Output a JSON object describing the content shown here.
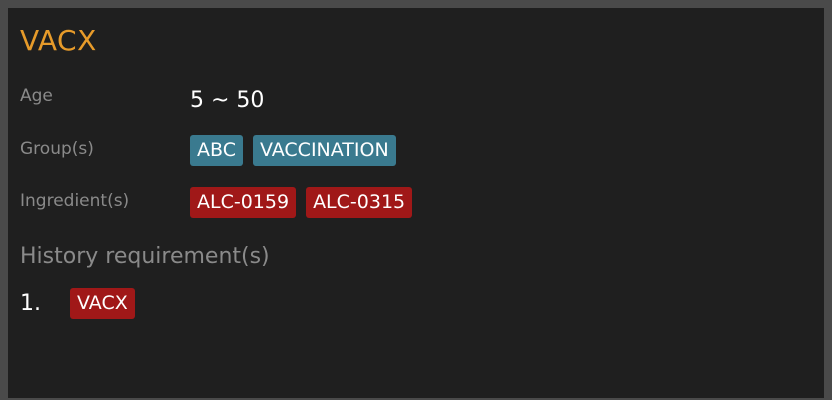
{
  "title": "VACX",
  "age": {
    "label": "Age",
    "value": "5 ~ 50"
  },
  "groups": {
    "label": "Group(s)",
    "tags": [
      "ABC",
      "VACCINATION"
    ],
    "color": "#3a7a8f"
  },
  "ingredients": {
    "label": "Ingredient(s)",
    "tags": [
      "ALC-0159",
      "ALC-0315"
    ],
    "color": "#a01818"
  },
  "history": {
    "heading": "History requirement(s)",
    "items": [
      {
        "index": "1.",
        "tag": "VACX"
      }
    ]
  },
  "colors": {
    "title": "#e79b2a",
    "background": "#1f1f1f",
    "label": "#8a8a8a"
  }
}
